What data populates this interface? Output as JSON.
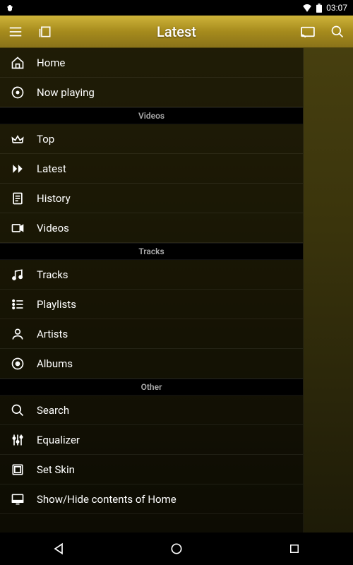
{
  "status": {
    "time": "03:07"
  },
  "header": {
    "title": "Latest"
  },
  "drawer": {
    "home": "Home",
    "now_playing": "Now playing",
    "sections": {
      "videos": {
        "label": "Videos",
        "items": {
          "top": "Top",
          "latest": "Latest",
          "history": "History",
          "videos": "Videos"
        }
      },
      "tracks": {
        "label": "Tracks",
        "items": {
          "tracks": "Tracks",
          "playlists": "Playlists",
          "artists": "Artists",
          "albums": "Albums"
        }
      },
      "other": {
        "label": "Other",
        "items": {
          "search": "Search",
          "equalizer": "Equalizer",
          "set_skin": "Set Skin",
          "show_hide": "Show/Hide contents of Home"
        }
      }
    }
  }
}
